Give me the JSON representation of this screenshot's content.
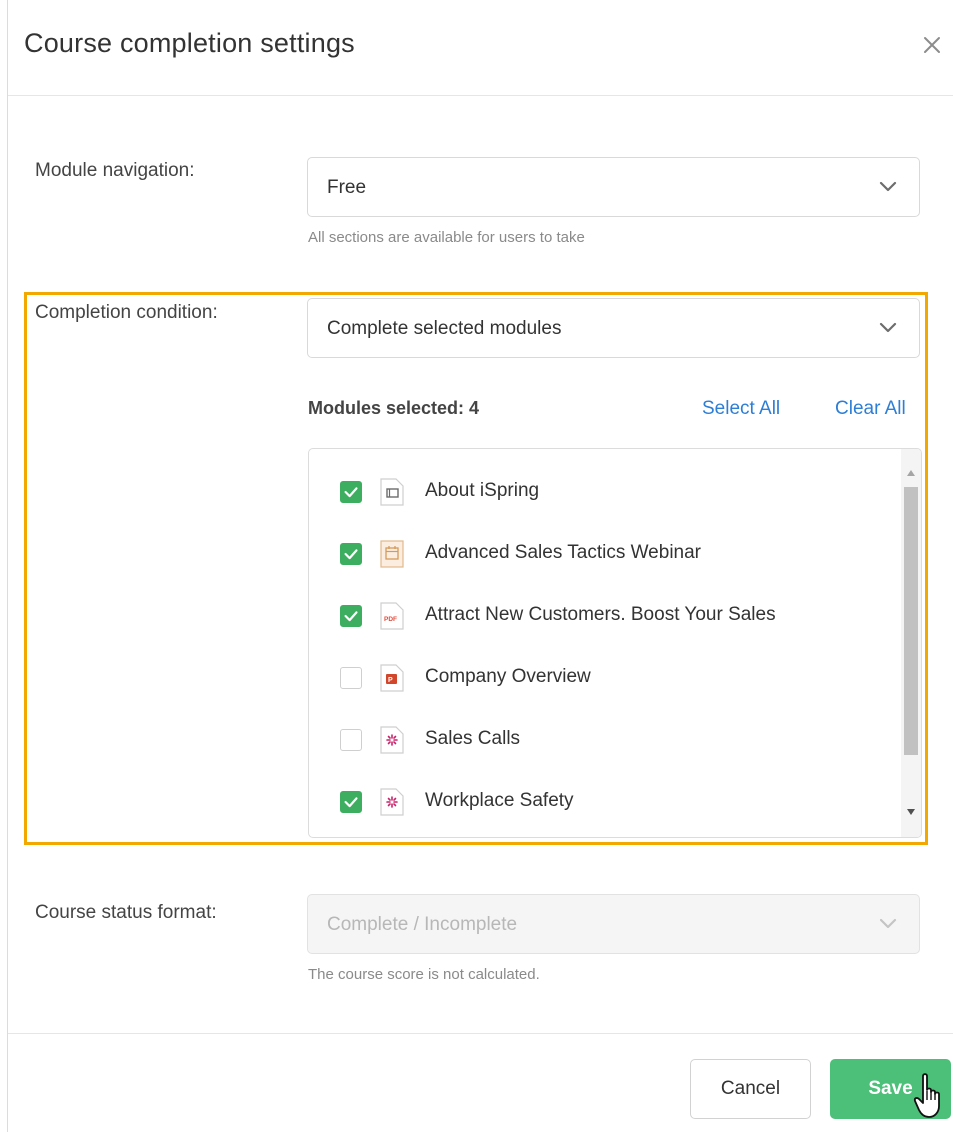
{
  "dialog": {
    "title": "Course completion settings",
    "close_icon": "close-icon"
  },
  "module_navigation": {
    "label": "Module navigation:",
    "value": "Free",
    "hint": "All sections are available for users to take"
  },
  "completion_condition": {
    "label": "Completion condition:",
    "value": "Complete selected modules",
    "modules_selected_label": "Modules selected: 4",
    "select_all": "Select All",
    "clear_all": "Clear All",
    "modules": [
      {
        "name": "About iSpring",
        "checked": true,
        "icon": "slide-file-icon"
      },
      {
        "name": "Advanced Sales Tactics Webinar",
        "checked": true,
        "icon": "calendar-file-icon"
      },
      {
        "name": "Attract New Customers. Boost Your Sales",
        "checked": true,
        "icon": "pdf-file-icon"
      },
      {
        "name": "Company Overview",
        "checked": false,
        "icon": "powerpoint-file-icon"
      },
      {
        "name": "Sales Calls",
        "checked": false,
        "icon": "interaction-file-icon"
      },
      {
        "name": "Workplace Safety",
        "checked": true,
        "icon": "interaction-file-icon"
      }
    ]
  },
  "course_status": {
    "label": "Course status format:",
    "value": "Complete / Incomplete",
    "hint": "The course score is not calculated."
  },
  "footer": {
    "cancel_label": "Cancel",
    "save_label": "Save"
  },
  "colors": {
    "accent_green": "#4cbf79",
    "checkbox_green": "#3dae60",
    "link_blue": "#2d7ed6",
    "highlight_orange": "#f2a800"
  }
}
